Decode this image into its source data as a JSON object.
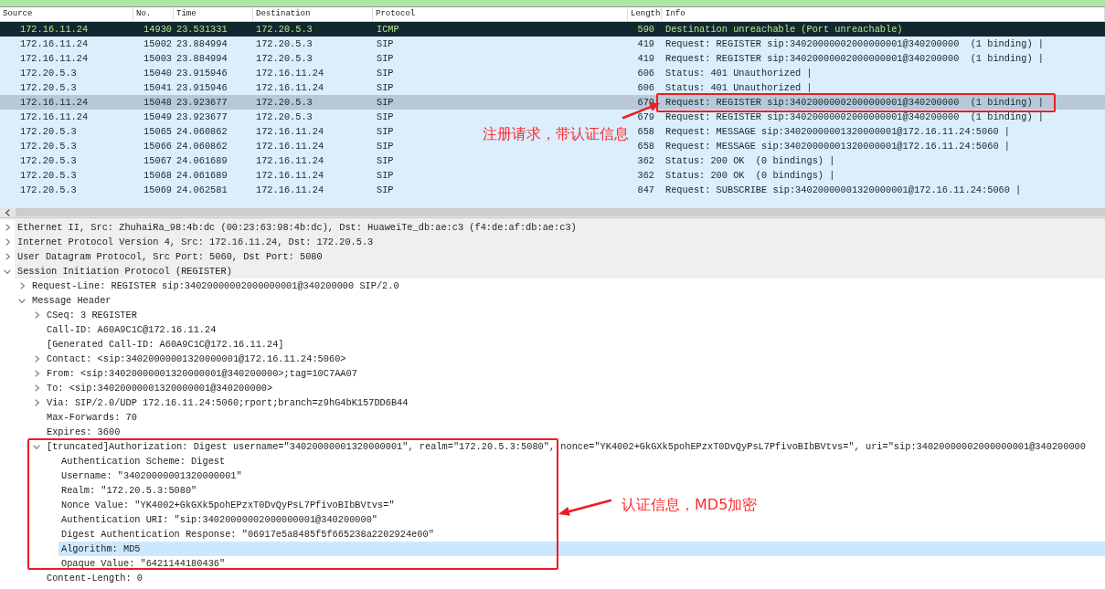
{
  "packet_list": {
    "columns": [
      "Source",
      "No.",
      "Time",
      "Destination",
      "Protocol",
      "Length",
      "Info"
    ],
    "rows": [
      {
        "source": "172.16.11.24",
        "no": "14930",
        "time": "23.531331",
        "destination": "172.20.5.3",
        "protocol": "ICMP",
        "length": "590",
        "info": "Destination unreachable (Port unreachable)",
        "kind": "error",
        "selected": false
      },
      {
        "source": "172.16.11.24",
        "no": "15002",
        "time": "23.884994",
        "destination": "172.20.5.3",
        "protocol": "SIP",
        "length": "419",
        "info": "Request: REGISTER sip:34020000002000000001@340200000  (1 binding) |",
        "kind": "udp",
        "selected": false
      },
      {
        "source": "172.16.11.24",
        "no": "15003",
        "time": "23.884994",
        "destination": "172.20.5.3",
        "protocol": "SIP",
        "length": "419",
        "info": "Request: REGISTER sip:34020000002000000001@340200000  (1 binding) |",
        "kind": "udp",
        "selected": false
      },
      {
        "source": "172.20.5.3",
        "no": "15040",
        "time": "23.915946",
        "destination": "172.16.11.24",
        "protocol": "SIP",
        "length": "606",
        "info": "Status: 401 Unauthorized |",
        "kind": "udp",
        "selected": false
      },
      {
        "source": "172.20.5.3",
        "no": "15041",
        "time": "23.915946",
        "destination": "172.16.11.24",
        "protocol": "SIP",
        "length": "606",
        "info": "Status: 401 Unauthorized |",
        "kind": "udp",
        "selected": false
      },
      {
        "source": "172.16.11.24",
        "no": "15048",
        "time": "23.923677",
        "destination": "172.20.5.3",
        "protocol": "SIP",
        "length": "679",
        "info": "Request: REGISTER sip:34020000002000000001@340200000  (1 binding) |",
        "kind": "udp",
        "selected": true
      },
      {
        "source": "172.16.11.24",
        "no": "15049",
        "time": "23.923677",
        "destination": "172.20.5.3",
        "protocol": "SIP",
        "length": "679",
        "info": "Request: REGISTER sip:34020000002000000001@340200000  (1 binding) |",
        "kind": "udp",
        "selected": false
      },
      {
        "source": "172.20.5.3",
        "no": "15065",
        "time": "24.060862",
        "destination": "172.16.11.24",
        "protocol": "SIP",
        "length": "658",
        "info": "Request: MESSAGE sip:34020000001320000001@172.16.11.24:5060 |",
        "kind": "udp",
        "selected": false
      },
      {
        "source": "172.20.5.3",
        "no": "15066",
        "time": "24.060862",
        "destination": "172.16.11.24",
        "protocol": "SIP",
        "length": "658",
        "info": "Request: MESSAGE sip:34020000001320000001@172.16.11.24:5060 |",
        "kind": "udp",
        "selected": false
      },
      {
        "source": "172.20.5.3",
        "no": "15067",
        "time": "24.061689",
        "destination": "172.16.11.24",
        "protocol": "SIP",
        "length": "362",
        "info": "Status: 200 OK  (0 bindings) |",
        "kind": "udp",
        "selected": false
      },
      {
        "source": "172.20.5.3",
        "no": "15068",
        "time": "24.061689",
        "destination": "172.16.11.24",
        "protocol": "SIP",
        "length": "362",
        "info": "Status: 200 OK  (0 bindings) |",
        "kind": "udp",
        "selected": false
      },
      {
        "source": "172.20.5.3",
        "no": "15069",
        "time": "24.062581",
        "destination": "172.16.11.24",
        "protocol": "SIP",
        "length": "847",
        "info": "Request: SUBSCRIBE sip:34020000001320000001@172.16.11.24:5060 |",
        "kind": "udp",
        "selected": false
      }
    ]
  },
  "details": {
    "items": [
      {
        "text": "Ethernet II, Src: ZhuhaiRa_98:4b:dc (00:23:63:98:4b:dc), Dst: HuaweiTe_db:ae:c3 (f4:de:af:db:ae:c3)",
        "kind": "branch",
        "expanded": false,
        "selected": false
      },
      {
        "text": "Internet Protocol Version 4, Src: 172.16.11.24, Dst: 172.20.5.3",
        "kind": "branch",
        "expanded": false,
        "selected": false
      },
      {
        "text": "User Datagram Protocol, Src Port: 5060, Dst Port: 5080",
        "kind": "branch",
        "expanded": false,
        "selected": false
      },
      {
        "text": "Session Initiation Protocol (REGISTER)",
        "kind": "branch",
        "expanded": true,
        "selected": false,
        "children": [
          {
            "text": "Request-Line: REGISTER sip:34020000002000000001@340200000 SIP/2.0",
            "kind": "branch",
            "expanded": false,
            "selected": false
          },
          {
            "text": "Message Header",
            "kind": "branch",
            "expanded": true,
            "selected": false,
            "children": [
              {
                "text": "CSeq: 3 REGISTER",
                "kind": "branch",
                "expanded": false,
                "selected": false
              },
              {
                "text": "Call-ID: A60A9C1C@172.16.11.24",
                "kind": "leaf",
                "selected": false
              },
              {
                "text": "[Generated Call-ID: A60A9C1C@172.16.11.24]",
                "kind": "leaf",
                "selected": false
              },
              {
                "text": "Contact: <sip:34020000001320000001@172.16.11.24:5060>",
                "kind": "branch",
                "expanded": false,
                "selected": false
              },
              {
                "text": "From: <sip:34020000001320000001@340200000>;tag=10C7AA07",
                "kind": "branch",
                "expanded": false,
                "selected": false
              },
              {
                "text": "To: <sip:34020000001320000001@340200000>",
                "kind": "branch",
                "expanded": false,
                "selected": false
              },
              {
                "text": "Via: SIP/2.0/UDP 172.16.11.24:5060;rport;branch=z9hG4bK157DD6B44",
                "kind": "branch",
                "expanded": false,
                "selected": false
              },
              {
                "text": "Max-Forwards: 70",
                "kind": "leaf",
                "selected": false
              },
              {
                "text": "Expires: 3600",
                "kind": "leaf",
                "selected": false
              },
              {
                "text": "[truncated]Authorization: Digest username=\"34020000001320000001\", realm=\"172.20.5.3:5080\", nonce=\"YK4002+GkGXk5pohEPzxT0DvQyPsL7PfivoBIbBVtvs=\", uri=\"sip:34020000002000000001@340200000",
                "kind": "branch",
                "expanded": true,
                "selected": false,
                "children": [
                  {
                    "text": "Authentication Scheme: Digest",
                    "kind": "leaf",
                    "selected": false
                  },
                  {
                    "text": "Username: \"34020000001320000001\"",
                    "kind": "leaf",
                    "selected": false
                  },
                  {
                    "text": "Realm: \"172.20.5.3:5080\"",
                    "kind": "leaf",
                    "selected": false
                  },
                  {
                    "text": "Nonce Value: \"YK4002+GkGXk5pohEPzxT0DvQyPsL7PfivoBIbBVtvs=\"",
                    "kind": "leaf",
                    "selected": false
                  },
                  {
                    "text": "Authentication URI: \"sip:34020000002000000001@340200000\"",
                    "kind": "leaf",
                    "selected": false
                  },
                  {
                    "text": "Digest Authentication Response: \"06917e5a8485f5f665238a2202924e00\"",
                    "kind": "leaf",
                    "selected": false
                  },
                  {
                    "text": "Algorithm: MD5",
                    "kind": "leaf",
                    "selected": true
                  },
                  {
                    "text": "Opaque Value: \"6421144180436\"",
                    "kind": "leaf",
                    "selected": false
                  }
                ]
              },
              {
                "text": "Content-Length: 0",
                "kind": "leaf",
                "selected": false
              }
            ]
          }
        ]
      }
    ]
  },
  "annotations": [
    {
      "text": "注册请求，带认证信息"
    },
    {
      "text": "认证信息，MD5加密"
    }
  ]
}
